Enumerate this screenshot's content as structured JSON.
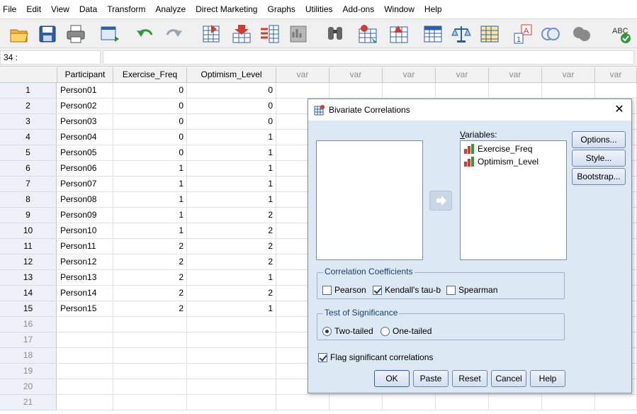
{
  "menu": [
    "File",
    "Edit",
    "View",
    "Data",
    "Transform",
    "Analyze",
    "Direct Marketing",
    "Graphs",
    "Utilities",
    "Add-ons",
    "Window",
    "Help"
  ],
  "toolbar_icons": [
    "open-icon",
    "save-icon",
    "print-icon",
    "dialog-recall-icon",
    "undo-icon",
    "redo-icon",
    "goto-case-icon",
    "goto-variable-icon",
    "variables-icon",
    "run-descriptive-icon",
    "find-icon",
    "insert-cases-icon",
    "insert-variable-icon",
    "split-file-icon",
    "weight-cases-icon",
    "select-cases-icon",
    "value-labels-icon",
    "use-sets-icon",
    "show-all-variables-icon",
    "spell-check-icon"
  ],
  "cell_ref": "34 :",
  "grid": {
    "columns": [
      "Participant",
      "Exercise_Freq",
      "Optimism_Level",
      "var",
      "var",
      "var",
      "var",
      "var",
      "var",
      "var"
    ],
    "rows": [
      [
        "1",
        "Person01",
        "0",
        "0"
      ],
      [
        "2",
        "Person02",
        "0",
        "0"
      ],
      [
        "3",
        "Person03",
        "0",
        "0"
      ],
      [
        "4",
        "Person04",
        "0",
        "1"
      ],
      [
        "5",
        "Person05",
        "0",
        "1"
      ],
      [
        "6",
        "Person06",
        "1",
        "1"
      ],
      [
        "7",
        "Person07",
        "1",
        "1"
      ],
      [
        "8",
        "Person08",
        "1",
        "1"
      ],
      [
        "9",
        "Person09",
        "1",
        "2"
      ],
      [
        "10",
        "Person10",
        "1",
        "2"
      ],
      [
        "11",
        "Person11",
        "2",
        "2"
      ],
      [
        "12",
        "Person12",
        "2",
        "2"
      ],
      [
        "13",
        "Person13",
        "2",
        "1"
      ],
      [
        "14",
        "Person14",
        "2",
        "2"
      ],
      [
        "15",
        "Person15",
        "2",
        "1"
      ]
    ],
    "empty_rows": [
      "16",
      "17",
      "18",
      "19",
      "20",
      "21"
    ]
  },
  "dialog": {
    "title": "Bivariate Correlations",
    "variables_label": "Variables:",
    "variables": [
      "Exercise_Freq",
      "Optimism_Level"
    ],
    "side_buttons": [
      "Options...",
      "Style...",
      "Bootstrap..."
    ],
    "coef_group": {
      "title": "Correlation Coefficients",
      "options": [
        {
          "label": "Pearson",
          "checked": false
        },
        {
          "label": "Kendall's tau-b",
          "checked": true
        },
        {
          "label": "Spearman",
          "checked": false
        }
      ]
    },
    "sig_group": {
      "title": "Test of Significance",
      "options": [
        {
          "label": "Two-tailed",
          "selected": true
        },
        {
          "label": "One-tailed",
          "selected": false
        }
      ]
    },
    "flag_label": "Flag significant correlations",
    "flag_checked": true,
    "bottom_buttons": [
      "OK",
      "Paste",
      "Reset",
      "Cancel",
      "Help"
    ]
  }
}
